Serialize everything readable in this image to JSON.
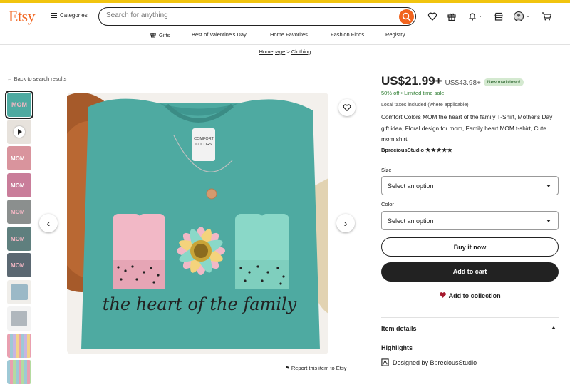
{
  "header": {
    "logo": "Etsy",
    "categories_label": "Categories",
    "search_placeholder": "Search for anything"
  },
  "nav": {
    "items": [
      "Gifts",
      "Best of Valentine's Day",
      "Home Favorites",
      "Fashion Finds",
      "Registry"
    ]
  },
  "breadcrumb": {
    "items": [
      "Homepage",
      "Clothing"
    ],
    "separator": ">"
  },
  "gallery": {
    "back_label": "Back to search results",
    "report_label": "Report this item to Etsy",
    "shirt_text_main": "MOM",
    "shirt_text_script": "the heart of the family",
    "tag_text_1": "COMFORT",
    "tag_text_2": "COLORS"
  },
  "product": {
    "price": "US$21.99+",
    "old_price": "US$43.98+",
    "badge": "New markdown!",
    "sale_text": "50% off • Limited time sale",
    "tax_text": "Local taxes included (where applicable)",
    "title": "Comfort Colors MOM the heart of the family T-Shirt, Mother's Day gift idea, Floral design for mom, Family heart MOM t-shirt, Cute mom shirt",
    "shop_name": "BpreciousStudio",
    "rating_stars": "★★★★★",
    "rating": 5
  },
  "options": {
    "size_label": "Size",
    "size_value": "Select an option",
    "color_label": "Color",
    "color_value": "Select an option"
  },
  "actions": {
    "buy_now": "Buy it now",
    "add_to_cart": "Add to cart",
    "add_to_collection": "Add to collection"
  },
  "details": {
    "item_details": "Item details",
    "highlights": "Highlights",
    "designed_by": "Designed by BpreciousStudio"
  },
  "colors": {
    "brand": "#f1641e",
    "shirt": "#4eaaa1",
    "sale_green": "#2e7d32"
  }
}
